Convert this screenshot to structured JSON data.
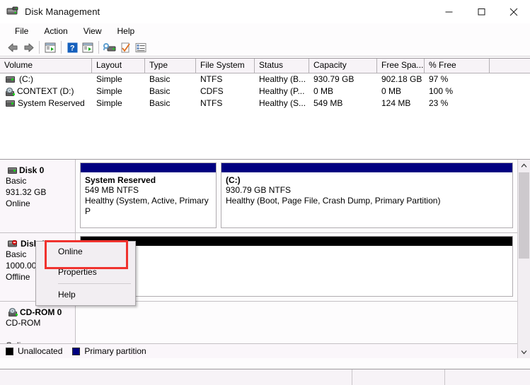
{
  "window": {
    "title": "Disk Management",
    "icon": "disk-management-icon",
    "controls": {
      "minimize": "minimize-icon",
      "maximize": "maximize-icon",
      "close": "close-icon"
    }
  },
  "menubar": {
    "items": [
      "File",
      "Action",
      "View",
      "Help"
    ]
  },
  "toolbar": {
    "buttons": [
      {
        "name": "back-icon"
      },
      {
        "name": "forward-icon"
      },
      {
        "name": "show-hide-console-tree-icon"
      },
      {
        "name": "help-icon"
      },
      {
        "name": "show-hide-action-pane-icon"
      },
      {
        "name": "rescan-disks-icon"
      },
      {
        "name": "properties-icon"
      },
      {
        "name": "all-tasks-icon"
      }
    ]
  },
  "volume_list": {
    "columns": [
      "Volume",
      "Layout",
      "Type",
      "File System",
      "Status",
      "Capacity",
      "Free Spa...",
      "% Free",
      ""
    ],
    "rows": [
      {
        "icon": "hard-drive-icon",
        "volume": "(C:)",
        "layout": "Simple",
        "type": "Basic",
        "file_system": "NTFS",
        "status": "Healthy (B...",
        "capacity": "930.79 GB",
        "free_space": "902.18 GB",
        "percent_free": "97 %"
      },
      {
        "icon": "cd-rom-icon",
        "volume": "CONTEXT (D:)",
        "layout": "Simple",
        "type": "Basic",
        "file_system": "CDFS",
        "status": "Healthy (P...",
        "capacity": "0 MB",
        "free_space": "0 MB",
        "percent_free": "100 %"
      },
      {
        "icon": "hard-drive-icon",
        "volume": "System Reserved",
        "layout": "Simple",
        "type": "Basic",
        "file_system": "NTFS",
        "status": "Healthy (S...",
        "capacity": "549 MB",
        "free_space": "124 MB",
        "percent_free": "23 %"
      }
    ]
  },
  "graphical_view": {
    "disks": [
      {
        "icon": "hard-drive-icon",
        "name": "Disk 0",
        "type": "Basic",
        "size": "931.32 GB",
        "state": "Online",
        "partitions": [
          {
            "label": "System Reserved",
            "size": "549 MB NTFS",
            "status": "Healthy (System, Active, Primary P",
            "cap_color": "#000080"
          },
          {
            "label": "(C:)",
            "size": "930.79 GB NTFS",
            "status": "Healthy (Boot, Page File, Crash Dump, Primary Partition)",
            "cap_color": "#000080"
          }
        ]
      },
      {
        "icon": "hard-drive-error-icon",
        "name": "Disk 1",
        "type": "Basic",
        "size": "1000.00",
        "state": "Offline",
        "partitions": [
          {
            "label": "",
            "size": "",
            "status": "",
            "cap_color": "#000000"
          }
        ]
      },
      {
        "icon": "cd-rom-icon",
        "name": "CD-ROM 0",
        "type": "CD-ROM",
        "size": "",
        "state": "Online",
        "partitions": []
      }
    ],
    "legend": [
      {
        "swatch": "#000000",
        "label": "Unallocated"
      },
      {
        "swatch": "#000080",
        "label": "Primary partition"
      }
    ],
    "scrollbar": {
      "up": "chevron-up-icon",
      "down": "chevron-down-icon"
    }
  },
  "context_menu": {
    "items": [
      {
        "label": "Online",
        "highlighted": true
      },
      {
        "label": "Properties",
        "highlighted": false
      },
      {
        "label": "Help",
        "highlighted": false
      }
    ],
    "highlight_color": "#f0322e"
  }
}
